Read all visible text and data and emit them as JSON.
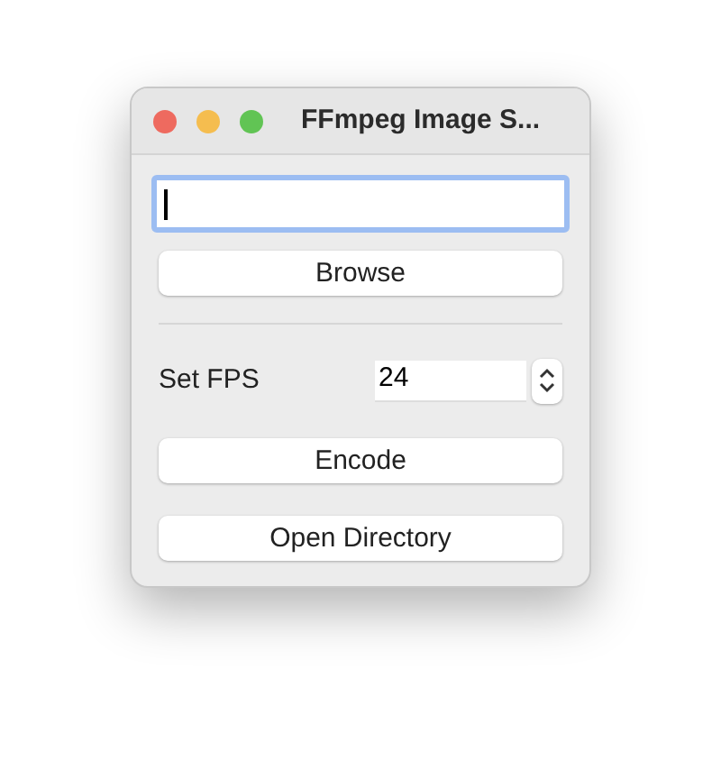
{
  "window": {
    "title": "FFmpeg Image S..."
  },
  "path_field": {
    "focused": true
  },
  "browse_button": "Browse",
  "fps": {
    "label": "Set FPS",
    "value": "24"
  },
  "buttons": [
    "Encode",
    "Open Directory"
  ]
}
